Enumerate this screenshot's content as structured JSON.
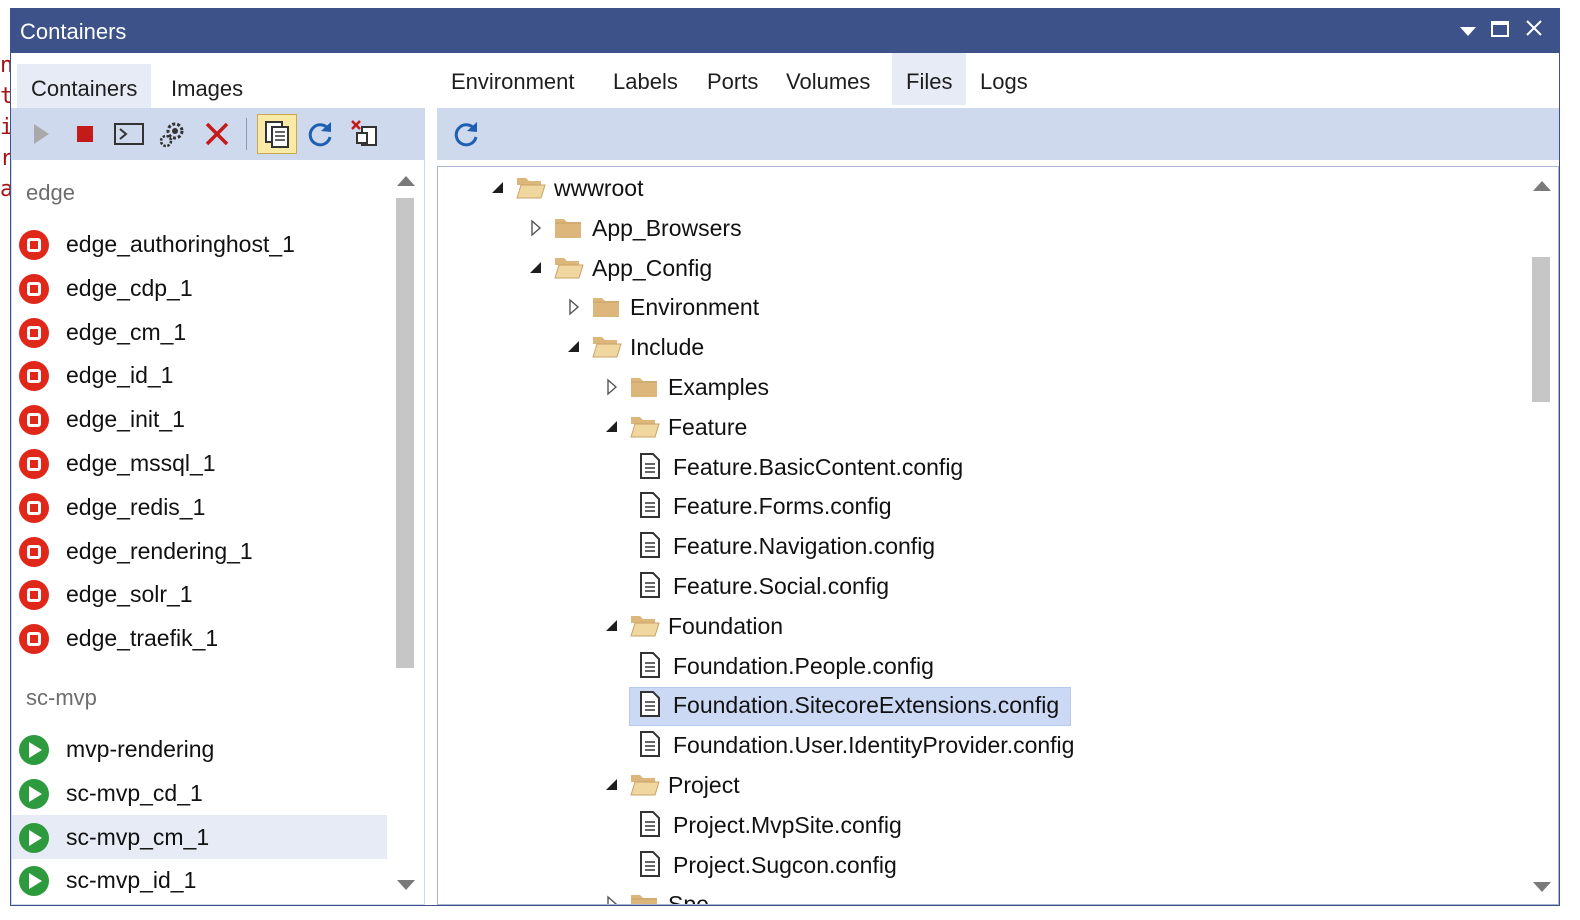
{
  "window": {
    "title": "Containers"
  },
  "background_code": [
    "ng",
    "t:",
    "i",
    "re",
    "at"
  ],
  "left_tabs": [
    {
      "label": "Containers",
      "active": true
    },
    {
      "label": "Images",
      "active": false
    }
  ],
  "left_toolbar": [
    "play-icon",
    "stop-icon",
    "terminal-icon",
    "settings-icon",
    "delete-icon",
    "copy-files-icon",
    "refresh-icon",
    "prune-icon"
  ],
  "groups": [
    {
      "name": "edge",
      "items": [
        {
          "label": "edge_authoringhost_1",
          "status": "stopped"
        },
        {
          "label": "edge_cdp_1",
          "status": "stopped"
        },
        {
          "label": "edge_cm_1",
          "status": "stopped"
        },
        {
          "label": "edge_id_1",
          "status": "stopped"
        },
        {
          "label": "edge_init_1",
          "status": "stopped"
        },
        {
          "label": "edge_mssql_1",
          "status": "stopped"
        },
        {
          "label": "edge_redis_1",
          "status": "stopped"
        },
        {
          "label": "edge_rendering_1",
          "status": "stopped"
        },
        {
          "label": "edge_solr_1",
          "status": "stopped"
        },
        {
          "label": "edge_traefik_1",
          "status": "stopped"
        }
      ]
    },
    {
      "name": "sc-mvp",
      "items": [
        {
          "label": "mvp-rendering",
          "status": "running"
        },
        {
          "label": "sc-mvp_cd_1",
          "status": "running"
        },
        {
          "label": "sc-mvp_cm_1",
          "status": "running",
          "selected": true
        },
        {
          "label": "sc-mvp_id_1",
          "status": "running"
        }
      ]
    }
  ],
  "right_tabs": [
    {
      "label": "Environment",
      "active": false
    },
    {
      "label": "Labels",
      "active": false
    },
    {
      "label": "Ports",
      "active": false
    },
    {
      "label": "Volumes",
      "active": false
    },
    {
      "label": "Files",
      "active": true
    },
    {
      "label": "Logs",
      "active": false
    }
  ],
  "tree": [
    {
      "label": "wwwroot",
      "type": "folder",
      "level": 0,
      "expanded": true
    },
    {
      "label": "App_Browsers",
      "type": "folder",
      "level": 1,
      "expanded": false
    },
    {
      "label": "App_Config",
      "type": "folder",
      "level": 1,
      "expanded": true
    },
    {
      "label": "Environment",
      "type": "folder",
      "level": 2,
      "expanded": false
    },
    {
      "label": "Include",
      "type": "folder",
      "level": 2,
      "expanded": true
    },
    {
      "label": "Examples",
      "type": "folder",
      "level": 3,
      "expanded": false
    },
    {
      "label": "Feature",
      "type": "folder",
      "level": 3,
      "expanded": true
    },
    {
      "label": "Feature.BasicContent.config",
      "type": "file",
      "level": 4
    },
    {
      "label": "Feature.Forms.config",
      "type": "file",
      "level": 4
    },
    {
      "label": "Feature.Navigation.config",
      "type": "file",
      "level": 4
    },
    {
      "label": "Feature.Social.config",
      "type": "file",
      "level": 4
    },
    {
      "label": "Foundation",
      "type": "folder",
      "level": 3,
      "expanded": true
    },
    {
      "label": "Foundation.People.config",
      "type": "file",
      "level": 4
    },
    {
      "label": "Foundation.SitecoreExtensions.config",
      "type": "file",
      "level": 4,
      "selected": true
    },
    {
      "label": "Foundation.User.IdentityProvider.config",
      "type": "file",
      "level": 4
    },
    {
      "label": "Project",
      "type": "folder",
      "level": 3,
      "expanded": true
    },
    {
      "label": "Project.MvpSite.config",
      "type": "file",
      "level": 4
    },
    {
      "label": "Project.Sugcon.config",
      "type": "file",
      "level": 4
    },
    {
      "label": "Spe",
      "type": "folder",
      "level": 3,
      "expanded": false
    }
  ]
}
